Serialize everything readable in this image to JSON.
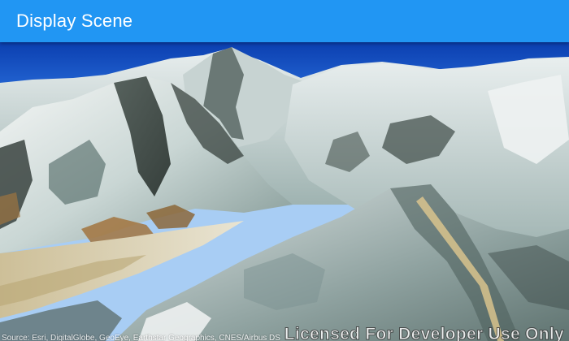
{
  "app_bar": {
    "title": "Display Scene",
    "color": "#2196F3"
  },
  "scene": {
    "attribution": "Source: Esri, DigitalGlobe, GeoEye, Earthstar Geographics, CNES/Airbus DS",
    "watermark": "Licensed For Developer Use Only"
  }
}
